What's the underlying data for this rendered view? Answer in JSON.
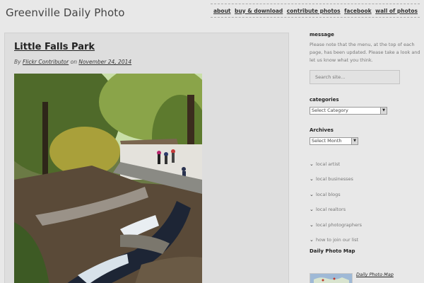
{
  "site": {
    "title": "Greenville Daily Photo"
  },
  "nav": {
    "items": [
      {
        "label": "about"
      },
      {
        "label": "buy & download"
      },
      {
        "label": "contribute photos"
      },
      {
        "label": "facebook"
      },
      {
        "label": "wall of photos"
      }
    ]
  },
  "post": {
    "title": "Little Falls Park",
    "by_prefix": "By",
    "author": "Flickr Contributor",
    "on_word": "on",
    "date": "November 24, 2014"
  },
  "sidebar": {
    "message_heading": "message",
    "message_text": "Please note that the menu, at the top of each page, has been updated. Please take a look and let us know what you think.",
    "search_placeholder": "Search site...",
    "categories_heading": "categories",
    "categories_select": "Select Category",
    "archives_heading": "Archives",
    "archives_select": "Select Month",
    "links": [
      {
        "label": "local artist"
      },
      {
        "label": "local businesses"
      },
      {
        "label": "local blogs"
      },
      {
        "label": "local realtors"
      },
      {
        "label": "local photographers"
      },
      {
        "label": "how to join our list"
      }
    ],
    "map_heading": "Daily Photo Map",
    "map_link": "Daily Photo Map"
  }
}
